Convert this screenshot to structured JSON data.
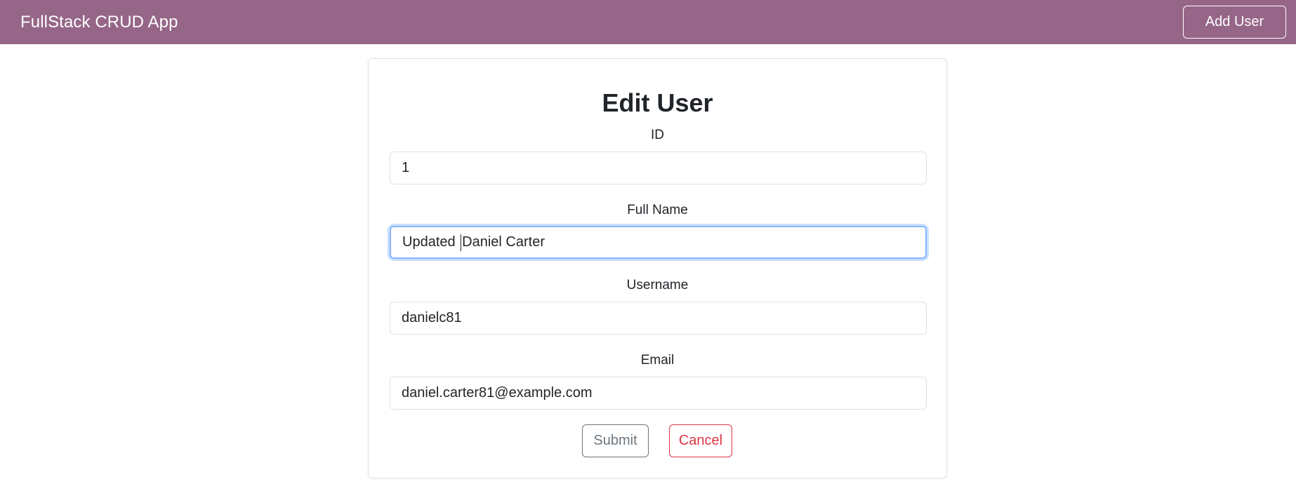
{
  "navbar": {
    "brand": "FullStack CRUD App",
    "add_user_label": "Add User",
    "background": "#966688"
  },
  "form": {
    "title": "Edit User",
    "fields": [
      {
        "label": "ID",
        "value": "1"
      },
      {
        "label": "Full Name",
        "value_before_caret": "Updated ",
        "value_after_caret": "Daniel Carter",
        "focused": true
      },
      {
        "label": "Username",
        "value": "danielc81"
      },
      {
        "label": "Email",
        "value": "daniel.carter81@example.com"
      }
    ],
    "submit_label": "Submit",
    "cancel_label": "Cancel"
  },
  "colors": {
    "submit": "#6c757d",
    "cancel": "#dc3545",
    "focus_ring": "#86b7fe"
  }
}
